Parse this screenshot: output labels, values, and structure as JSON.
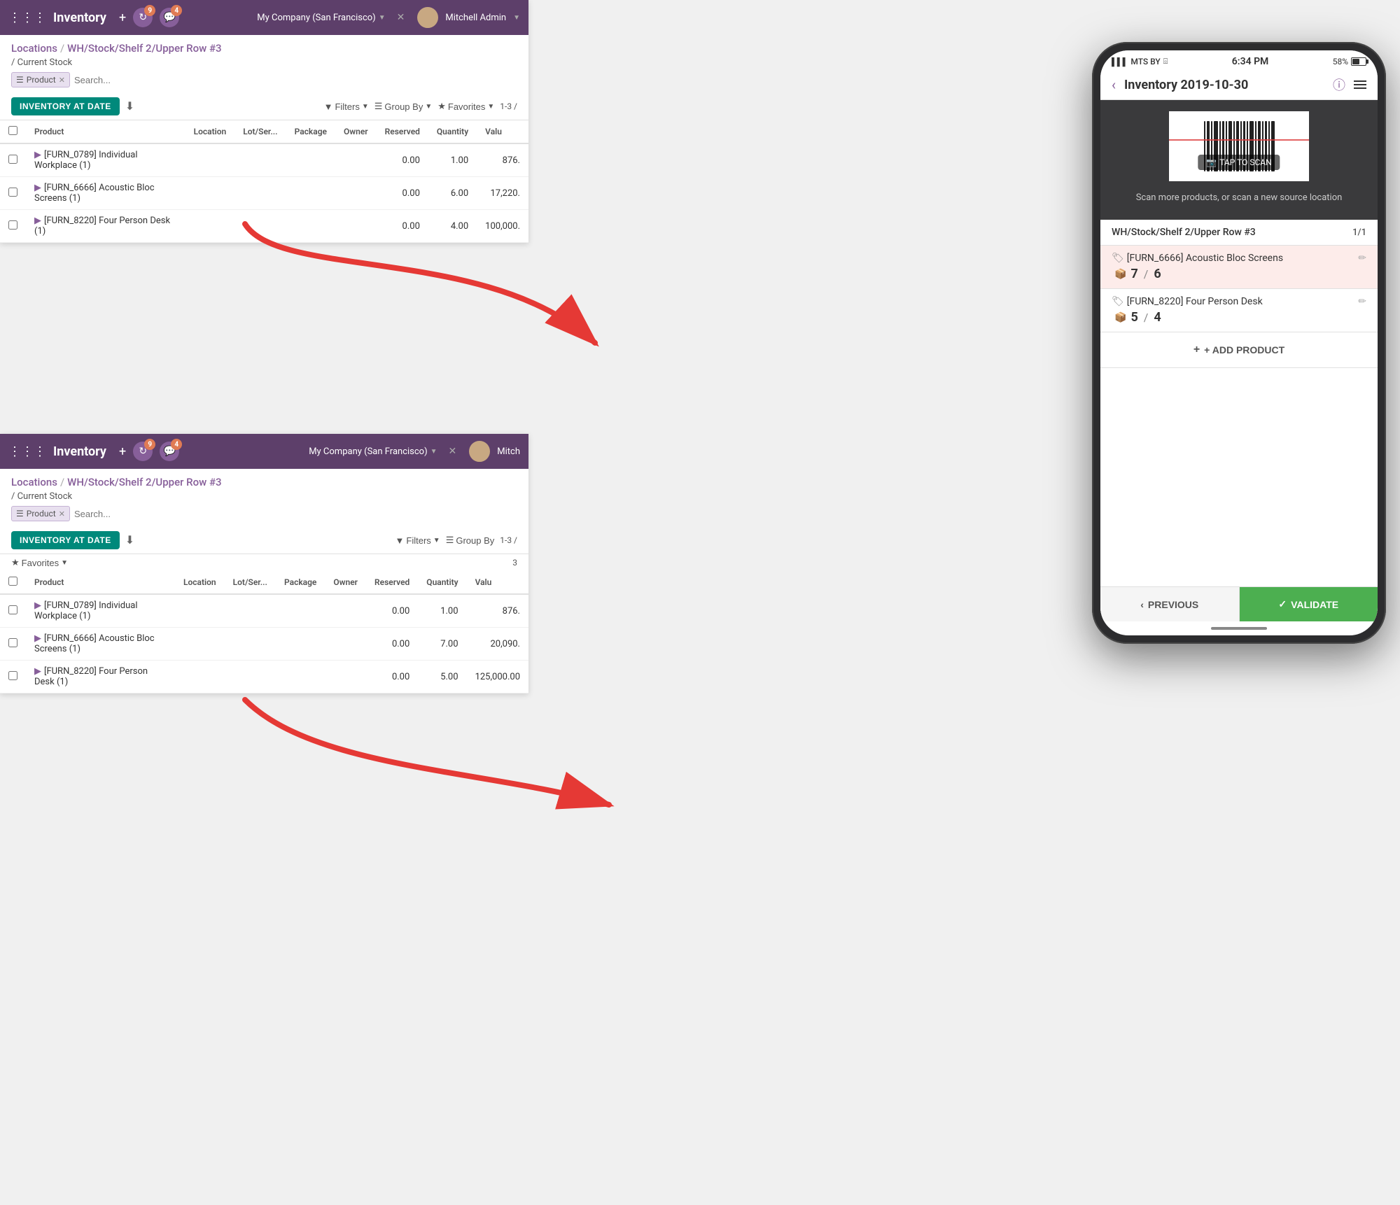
{
  "app": {
    "title": "Inventory",
    "nav": {
      "title": "Inventory",
      "plus": "+",
      "badge1_count": "9",
      "badge2_count": "4",
      "company": "My Company (San Francisco)",
      "username": "Mitchell Admin"
    }
  },
  "panel1": {
    "breadcrumb": {
      "locations": "Locations",
      "sep1": "/",
      "path": "WH/Stock/Shelf 2/Upper Row #3",
      "sep2": "/",
      "sub": "Current Stock"
    },
    "search": {
      "tag_label": "Product",
      "placeholder": "Search..."
    },
    "toolbar": {
      "inv_date_btn": "INVENTORY AT DATE",
      "filters_btn": "Filters",
      "groupby_btn": "Group By",
      "favorites_btn": "Favorites",
      "page_info": "1-3 /"
    },
    "table": {
      "headers": [
        "",
        "Product",
        "Location",
        "Lot/Ser...",
        "Package",
        "Owner",
        "Reserved",
        "Quantity",
        "Valu"
      ],
      "rows": [
        {
          "toggle": "▶",
          "product": "[FURN_0789] Individual Workplace (1)",
          "reserved": "0.00",
          "quantity": "1.00",
          "value": "876."
        },
        {
          "toggle": "▶",
          "product": "[FURN_6666] Acoustic Bloc Screens (1)",
          "reserved": "0.00",
          "quantity": "6.00",
          "value": "17,220."
        },
        {
          "toggle": "▶",
          "product": "[FURN_8220] Four Person Desk (1)",
          "reserved": "0.00",
          "quantity": "4.00",
          "value": "100,000."
        }
      ]
    }
  },
  "panel2": {
    "breadcrumb": {
      "locations": "Locations",
      "sep1": "/",
      "path": "WH/Stock/Shelf 2/Upper Row #3",
      "sep2": "/",
      "sub": "Current Stock"
    },
    "search": {
      "tag_label": "Product",
      "placeholder": "Search..."
    },
    "toolbar": {
      "inv_date_btn": "INVENTORY AT DATE",
      "filters_btn": "Filters",
      "groupby_btn": "Group By",
      "favorites_btn": "Favorites",
      "page_info": "1-3 /",
      "total": "3"
    },
    "table": {
      "headers": [
        "",
        "Product",
        "Location",
        "Lot/Ser...",
        "Package",
        "Owner",
        "Reserved",
        "Quantity",
        "Valu"
      ],
      "rows": [
        {
          "toggle": "▶",
          "product": "[FURN_0789] Individual Workplace (1)",
          "reserved": "0.00",
          "quantity": "1.00",
          "value": "876."
        },
        {
          "toggle": "▶",
          "product": "[FURN_6666] Acoustic Bloc Screens (1)",
          "reserved": "0.00",
          "quantity": "7.00",
          "value": "20,090."
        },
        {
          "toggle": "▶",
          "product": "[FURN_8220] Four Person Desk (1)",
          "reserved": "0.00",
          "quantity": "5.00",
          "value": "125,000.00"
        }
      ]
    }
  },
  "mobile": {
    "status": {
      "carrier": "MTS BY",
      "wifi": "WiFi",
      "time": "6:34 PM",
      "battery": "58%"
    },
    "header": {
      "title": "Inventory 2019-10-30"
    },
    "scanner": {
      "description": "Scan more products, or scan a new source location",
      "tap_label": "TAP TO SCAN"
    },
    "location": {
      "name": "WH/Stock/Shelf 2/Upper Row #3",
      "count": "1/1"
    },
    "products": [
      {
        "name": "[FURN_6666] Acoustic Bloc Screens",
        "qty_counted": "7",
        "qty_expected": "6",
        "highlighted": true
      },
      {
        "name": "[FURN_8220] Four Person Desk",
        "qty_counted": "5",
        "qty_expected": "4",
        "highlighted": false
      }
    ],
    "add_product_btn": "+ ADD PRODUCT",
    "previous_btn": "PREVIOUS",
    "validate_btn": "VALIDATE"
  }
}
